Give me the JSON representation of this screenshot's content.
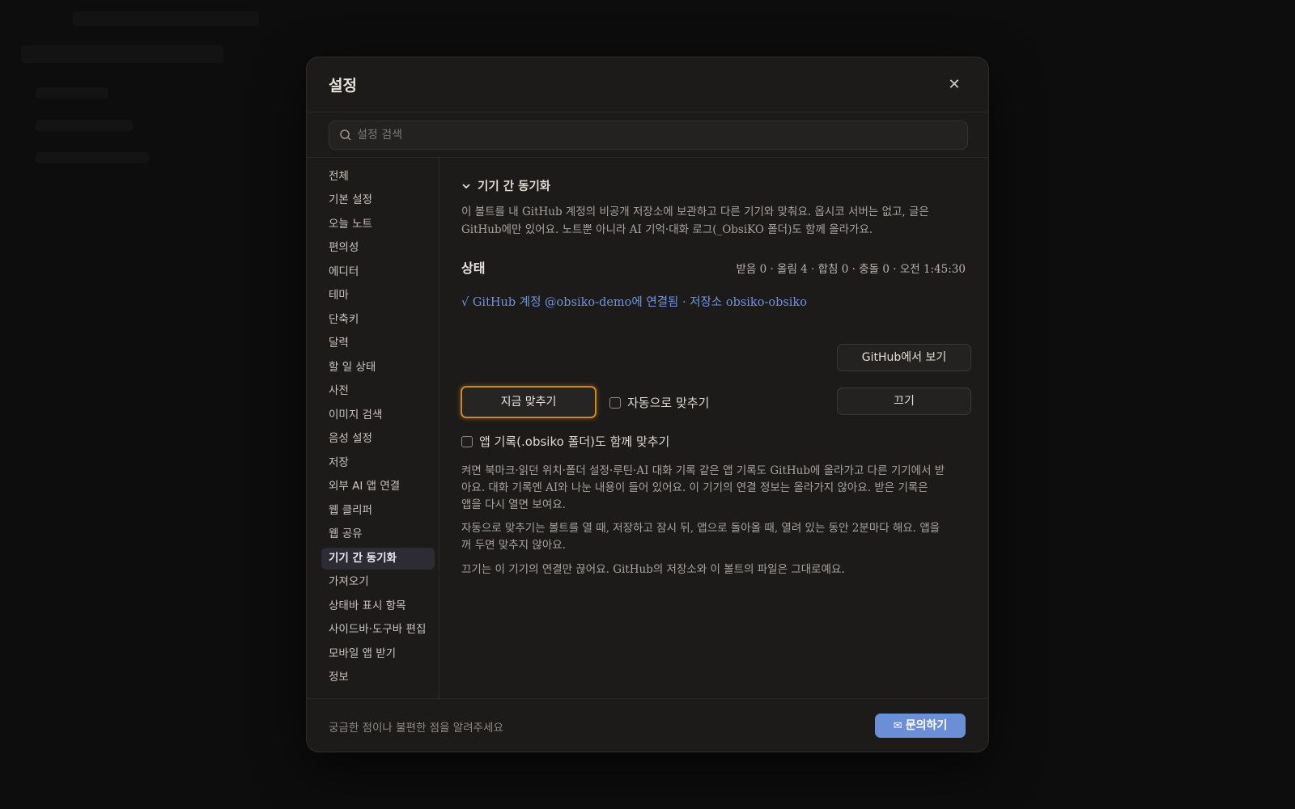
{
  "dialog": {
    "title": "설정",
    "close_icon": "close-icon"
  },
  "search": {
    "placeholder": "설정 검색"
  },
  "sidebar": {
    "items": [
      {
        "label": "전체"
      },
      {
        "label": "기본 설정"
      },
      {
        "label": "오늘 노트"
      },
      {
        "label": "편의성"
      },
      {
        "label": "에디터"
      },
      {
        "label": "테마"
      },
      {
        "label": "단축키"
      },
      {
        "label": "달력"
      },
      {
        "label": "할 일 상태"
      },
      {
        "label": "사전"
      },
      {
        "label": "이미지 검색"
      },
      {
        "label": "음성 설정"
      },
      {
        "label": "저장"
      },
      {
        "label": "외부 AI 앱 연결"
      },
      {
        "label": "웹 클리퍼"
      },
      {
        "label": "웹 공유"
      },
      {
        "label": "기기 간 동기화",
        "active": true
      },
      {
        "label": "가져오기"
      },
      {
        "label": "상태바 표시 항목"
      },
      {
        "label": "사이드바·도구바 편집"
      },
      {
        "label": "모바일 앱 받기"
      },
      {
        "label": "정보"
      }
    ]
  },
  "sync": {
    "section_title": "기기 간 동기화",
    "intro_line1": "이 볼트를 내 GitHub 계정의 비공개 저장소에 보관하고 다른 기기와 맞춰요. 옵시코 서버는 없고, 글은",
    "intro_line2": "GitHub에만 있어요. 노트뿐 아니라 AI 기억·대화 로그(_ObsiKO 폴더)도 함께 올라가요.",
    "status_label": "상태",
    "status_text": "받음 0 · 올림 4 · 합침 0 · 충돌 0 · 오전 1:45:30",
    "linked_text": "√ GitHub 계정 @obsiko-demo에 연결됨 · 저장소 obsiko-obsiko",
    "view_github_label": "GitHub에서 보기",
    "sync_now_label": "지금 맞추기",
    "auto_sync_label": "자동으로 맞추기",
    "auto_sync_checked": false,
    "disconnect_label": "끄기",
    "app_records_label": "앱 기록(.obsiko 폴더)도 함께 맞추기",
    "app_records_checked": false,
    "note1_line1": "켜면 북마크·읽던 위치·폴더 설정·루틴·AI 대화 기록 같은 앱 기록도 GitHub에 올라가고 다른 기기에서 받",
    "note1_line2": "아요. 대화 기록엔 AI와 나눈 내용이 들어 있어요. 이 기기의 연결 정보는 올라가지 않아요. 받은 기록은",
    "note1_line3": "앱을 다시 열면 보여요.",
    "note2_line1": "자동으로 맞추기는 볼트를 열 때, 저장하고 잠시 뒤, 앱으로 돌아올 때, 열려 있는 동안 2분마다 해요. 앱을",
    "note2_line2": "꺼 두면 맞추지 않아요.",
    "note3": "끄기는 이 기기의 연결만 끊어요. GitHub의 저장소와 이 볼트의 파일은 그대로예요."
  },
  "footer": {
    "text": "궁금한 점이나 불편한 점을 알려주세요",
    "contact_label": "문의하기",
    "contact_icon": "mail-icon"
  },
  "colors": {
    "accent": "#6b8fd6",
    "focus": "#c98a2a",
    "link": "#6f95e0"
  }
}
